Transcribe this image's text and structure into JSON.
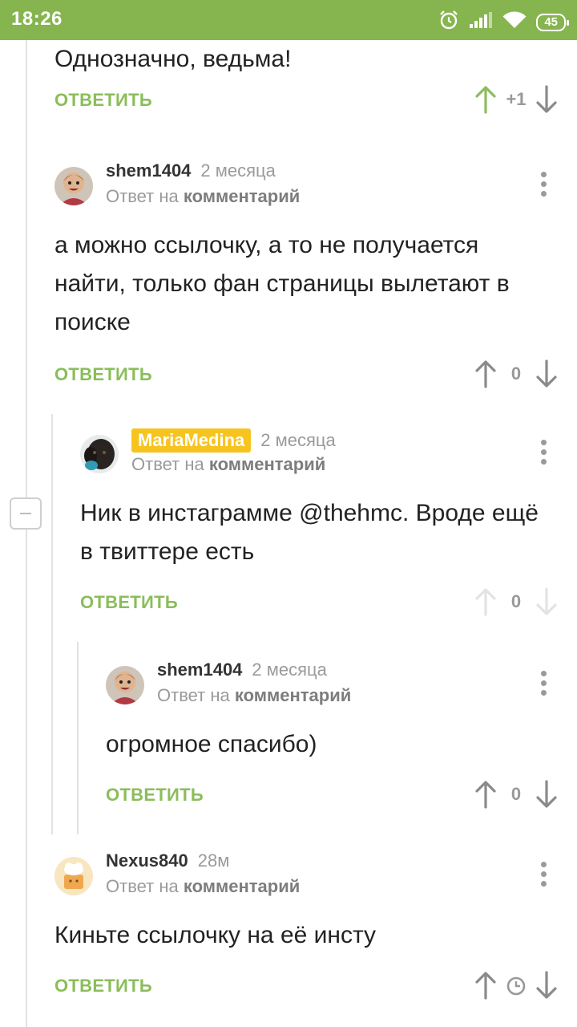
{
  "status_bar": {
    "time": "18:26",
    "battery": "45",
    "accent_color": "#86b54f",
    "icons": [
      "alarm-icon",
      "signal-icon",
      "wifi-icon",
      "battery-icon"
    ]
  },
  "comments": [
    {
      "text": "Однозначно, ведьма!",
      "reply_label": "ОТВЕТИТЬ",
      "score": "+1"
    },
    {
      "author": "shem1404",
      "time": "2 месяца",
      "reply_prefix": "Ответ на",
      "reply_link": "комментарий",
      "text": "а можно ссылочку, а то не получается найти, только фан страницы вылетают в поиске",
      "reply_label": "ОТВЕТИТЬ",
      "score": "0"
    },
    {
      "author": "MariaMedina",
      "time": "2 месяца",
      "reply_prefix": "Ответ на",
      "reply_link": "комментарий",
      "text": "Ник в инстаграмме @thehmc. Вроде ещё в твиттере есть",
      "reply_label": "ОТВЕТИТЬ",
      "score": "0"
    },
    {
      "author": "shem1404",
      "time": "2 месяца",
      "reply_prefix": "Ответ на",
      "reply_link": "комментарий",
      "text": "огромное спасибо)",
      "reply_label": "ОТВЕТИТЬ",
      "score": "0"
    },
    {
      "author": "Nexus840",
      "time": "28м",
      "reply_prefix": "Ответ на",
      "reply_link": "комментарий",
      "text": "Киньте ссылочку на её инсту",
      "reply_label": "ОТВЕТИТЬ",
      "score_icon": "clock-icon"
    }
  ]
}
